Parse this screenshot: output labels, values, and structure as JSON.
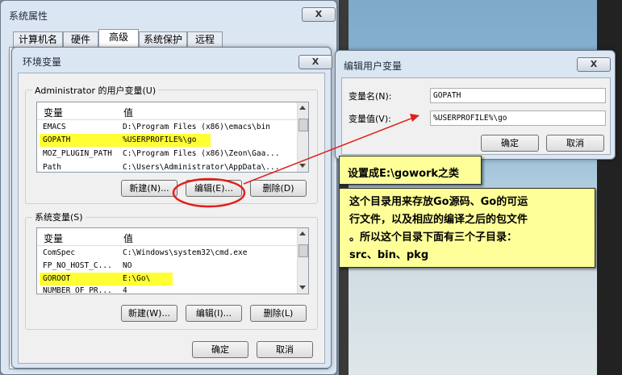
{
  "sysprops": {
    "title": "系统属性",
    "close": "X",
    "tabs": [
      "计算机名",
      "硬件",
      "高级",
      "系统保护",
      "远程"
    ]
  },
  "envdialog": {
    "title": "环境变量",
    "close": "X",
    "user_group": "Administrator 的用户变量(U)",
    "system_group": "系统变量(S)",
    "col_var": "变量",
    "col_val": "值",
    "user_rows": [
      {
        "name": "EMACS",
        "value": "D:\\Program Files (x86)\\emacs\\bin"
      },
      {
        "name": "GOPATH",
        "value": "%USERPROFILE%\\go"
      },
      {
        "name": "MOZ_PLUGIN_PATH",
        "value": "C:\\Program Files (x86)\\Zeon\\Gaa..."
      },
      {
        "name": "Path",
        "value": "C:\\Users\\Administrator\\AppData\\..."
      }
    ],
    "system_rows": [
      {
        "name": "ComSpec",
        "value": "C:\\Windows\\system32\\cmd.exe"
      },
      {
        "name": "FP_NO_HOST_C...",
        "value": "NO"
      },
      {
        "name": "GOROOT",
        "value": "E:\\Go\\"
      },
      {
        "name": "NUMBER_OF_PR...",
        "value": "4"
      }
    ],
    "user_new": "新建(N)...",
    "user_edit": "编辑(E)...",
    "user_delete": "删除(D)",
    "sys_new": "新建(W)...",
    "sys_edit": "编辑(I)...",
    "sys_delete": "删除(L)",
    "ok": "确定",
    "cancel": "取消"
  },
  "editdialog": {
    "title": "编辑用户变量",
    "close": "X",
    "name_label": "变量名(N):",
    "value_label": "变量值(V):",
    "name_value": "GOPATH",
    "value_value": "%USERPROFILE%\\go",
    "ok": "确定",
    "cancel": "取消"
  },
  "annotations": {
    "note1": "设置成E:\\gowork之类",
    "note2_lines": [
      "这个目录用来存放Go源码、Go的可运",
      "行文件，以及相应的编译之后的包文件",
      "。所以这个目录下面有三个子目录：",
      "src、bin、pkg"
    ],
    "arrow_color": "#e0201a",
    "highlight_color": "#ffff33"
  }
}
